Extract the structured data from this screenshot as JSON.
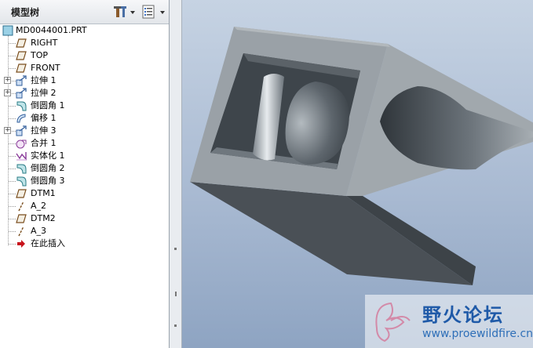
{
  "model_tree": {
    "title": "模型树",
    "root_label": "MD0044001.PRT",
    "items": [
      {
        "label": "RIGHT",
        "icon": "datum-plane-icon",
        "expandable": false
      },
      {
        "label": "TOP",
        "icon": "datum-plane-icon",
        "expandable": false
      },
      {
        "label": "FRONT",
        "icon": "datum-plane-icon",
        "expandable": false
      },
      {
        "label": "拉伸 1",
        "icon": "extrude-icon",
        "expandable": true
      },
      {
        "label": "拉伸 2",
        "icon": "extrude-icon",
        "expandable": true
      },
      {
        "label": "倒圆角 1",
        "icon": "round-icon",
        "expandable": false
      },
      {
        "label": "偏移 1",
        "icon": "offset-icon",
        "expandable": false
      },
      {
        "label": "拉伸 3",
        "icon": "extrude-icon",
        "expandable": true
      },
      {
        "label": "合并 1",
        "icon": "merge-icon",
        "expandable": false
      },
      {
        "label": "实体化 1",
        "icon": "solidify-icon",
        "expandable": false
      },
      {
        "label": "倒圆角 2",
        "icon": "round-icon",
        "expandable": false
      },
      {
        "label": "倒圆角 3",
        "icon": "round-icon",
        "expandable": false
      },
      {
        "label": "DTM1",
        "icon": "datum-plane-icon",
        "expandable": false
      },
      {
        "label": "A_2",
        "icon": "datum-axis-icon",
        "expandable": false
      },
      {
        "label": "DTM2",
        "icon": "datum-plane-icon",
        "expandable": false
      },
      {
        "label": "A_3",
        "icon": "datum-axis-icon",
        "expandable": false
      },
      {
        "label": "在此插入",
        "icon": "insert-here-arrow-icon",
        "expandable": false
      }
    ]
  },
  "toolbar": {
    "settings_icon": "tools-icon",
    "show_icon": "list-icon"
  },
  "watermark": {
    "text": "野火论坛",
    "url": "www.proewildfire.cn"
  },
  "colors": {
    "viewport_top": "#c6d3e3",
    "viewport_bottom": "#8ea4c2",
    "model_light": "#9aa2a8",
    "model_dark": "#3f454b"
  }
}
